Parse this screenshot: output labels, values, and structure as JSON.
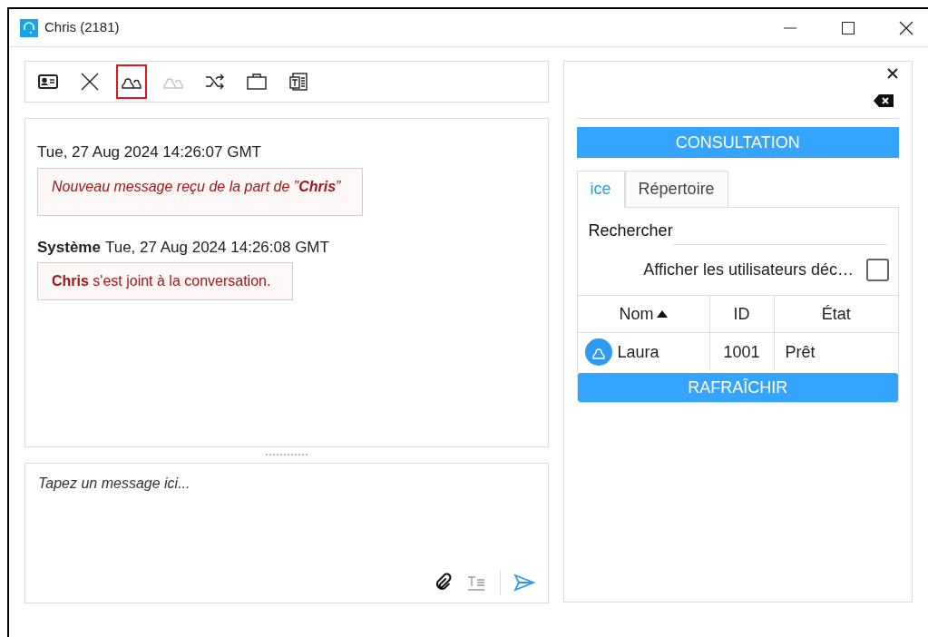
{
  "window": {
    "title": "Chris (2181)"
  },
  "toolbar": [
    {
      "kind": "contact-card",
      "highlighted": false,
      "disabled": false
    },
    {
      "kind": "close",
      "highlighted": false,
      "disabled": false
    },
    {
      "kind": "participants",
      "highlighted": true,
      "disabled": false
    },
    {
      "kind": "participants",
      "highlighted": false,
      "disabled": true
    },
    {
      "kind": "transfer",
      "highlighted": false,
      "disabled": false
    },
    {
      "kind": "case",
      "highlighted": false,
      "disabled": false
    },
    {
      "kind": "template",
      "highlighted": false,
      "disabled": false
    }
  ],
  "messages": [
    {
      "time": "Tue, 27 Aug 2024 14:26:07 GMT",
      "text": "Nouveau message reçu de la part de ”**Chris**”",
      "italic": true
    },
    {
      "sender": "Système",
      "time": "Tue, 27 Aug 2024 14:26:08 GMT",
      "text": "**Chris** s'est joint à la conversation.",
      "italic": false
    }
  ],
  "composer": {
    "placeholder": "Tapez un message ici..."
  },
  "panel": {
    "header": "CONSULTATION",
    "tabs": [
      {
        "label": "ice",
        "selected": true
      },
      {
        "label": "Répertoire",
        "selected": false
      }
    ],
    "search": {
      "label": "Rechercher"
    },
    "show_offline": {
      "label": "Afficher les utilisateurs déc…",
      "checked": false
    },
    "table": {
      "columns": [
        {
          "label": "Nom",
          "sorted": true
        },
        {
          "label": "ID"
        },
        {
          "label": "État"
        }
      ],
      "rows": [
        {
          "name": "Laura",
          "id": "1001",
          "state": "Prêt"
        }
      ]
    },
    "refresh_button": "RAFRAÎCHIR"
  }
}
